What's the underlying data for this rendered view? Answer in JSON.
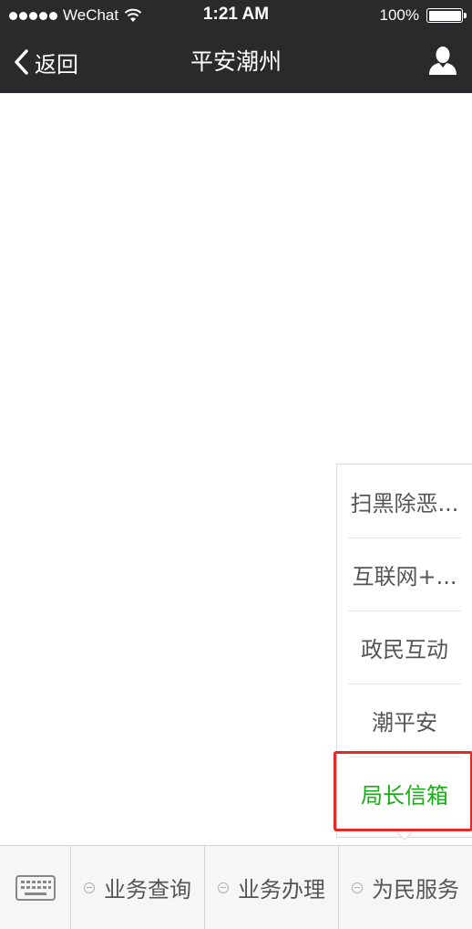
{
  "status_bar": {
    "carrier": "WeChat",
    "time": "1:21 AM",
    "battery": "100%"
  },
  "nav": {
    "back_label": "返回",
    "title": "平安潮州"
  },
  "submenu": {
    "items": [
      {
        "label": "扫黑除恶..."
      },
      {
        "label": "互联网+..."
      },
      {
        "label": "政民互动"
      },
      {
        "label": "潮平安"
      },
      {
        "label": "局长信箱"
      }
    ],
    "active_index": 4
  },
  "bottom_menu": {
    "tabs": [
      {
        "label": "业务查询"
      },
      {
        "label": "业务办理"
      },
      {
        "label": "为民服务"
      }
    ]
  },
  "colors": {
    "bar_background": "#2a2a2d",
    "active_text": "#1aad19",
    "highlight_border": "#e12b26"
  }
}
